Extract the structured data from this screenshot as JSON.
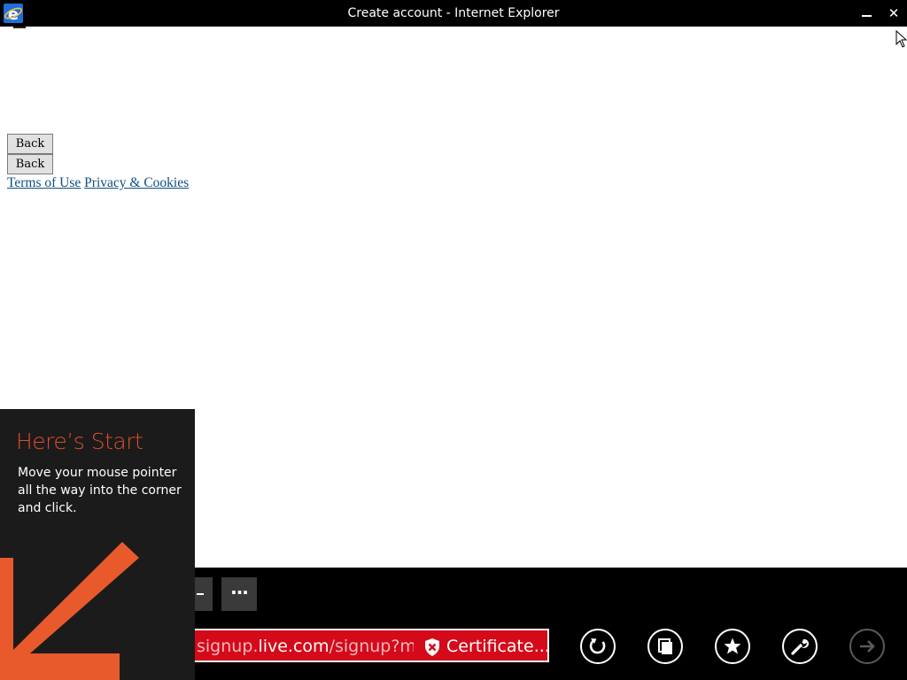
{
  "window": {
    "title": "Create account - Internet Explorer",
    "minimize_label": "–",
    "close_label": "✕"
  },
  "page": {
    "back_buttons": [
      "Back",
      "Back"
    ],
    "links": {
      "terms": "Terms of Use",
      "privacy": "Privacy & Cookies"
    }
  },
  "start_tip": {
    "title": "Here’s Start",
    "body": "Move your mouse pointer all the way into the corner and click."
  },
  "appbar": {
    "more_label": "···",
    "address_domain_prefix": "signup.",
    "address_domain": "live.com",
    "address_path": "/signup?ml",
    "certificate_label": "Certificate...",
    "icons": [
      "refresh-icon",
      "tabs-icon",
      "favorites-icon",
      "tools-icon",
      "forward-icon"
    ]
  },
  "colors": {
    "address_error": "#d40a1a",
    "tip_accent": "#e04a2e",
    "link": "#0e4f82"
  }
}
